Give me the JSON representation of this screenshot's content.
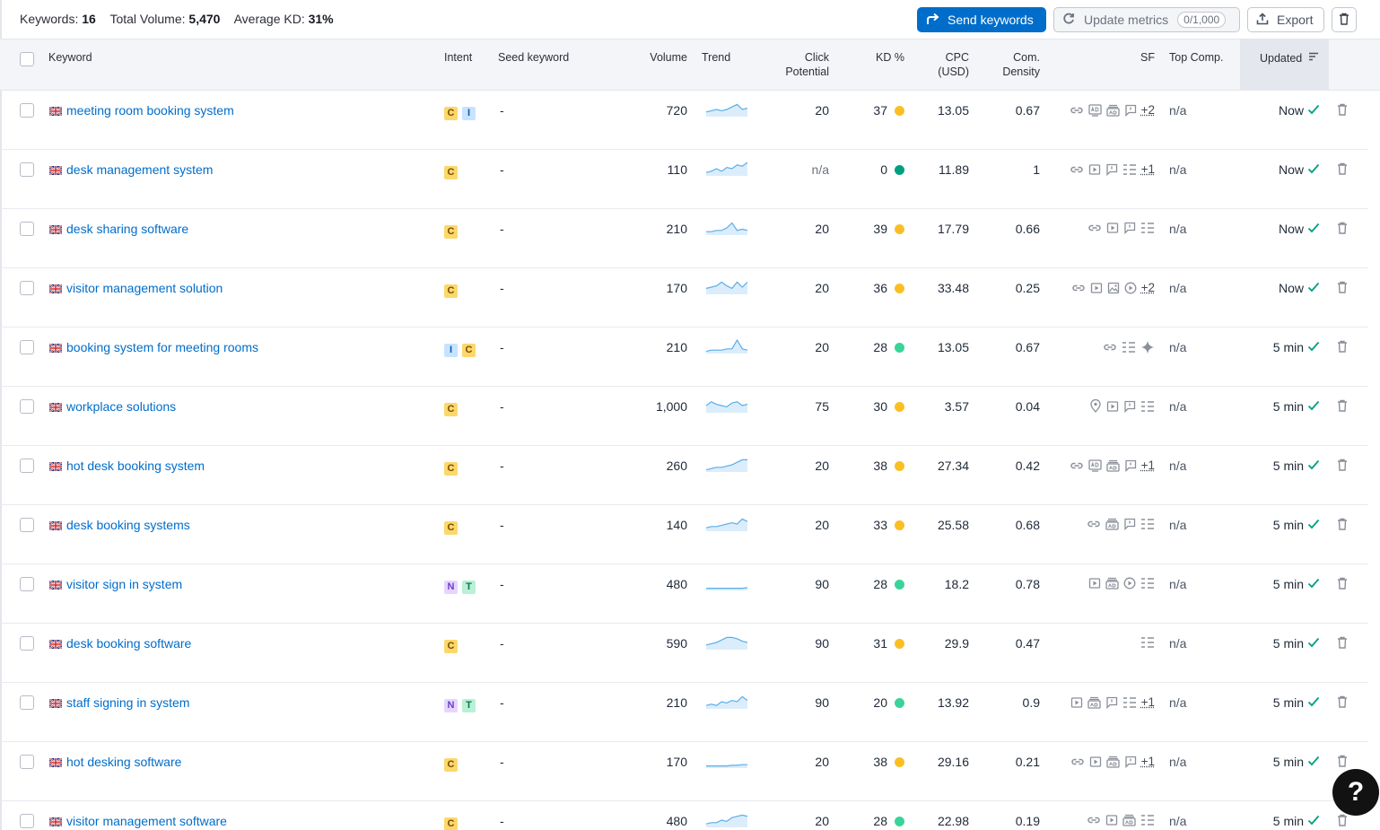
{
  "stats": {
    "keywords_label": "Keywords:",
    "keywords_value": "16",
    "volume_label": "Total Volume:",
    "volume_value": "5,470",
    "kd_label": "Average KD:",
    "kd_value": "31%"
  },
  "toolbar": {
    "send_label": "Send keywords",
    "update_label": "Update metrics",
    "update_limit": "0/1,000",
    "export_label": "Export"
  },
  "columns": {
    "keyword": "Keyword",
    "intent": "Intent",
    "seed": "Seed keyword",
    "volume": "Volume",
    "trend": "Trend",
    "click_1": "Click",
    "click_2": "Potential",
    "kd": "KD %",
    "cpc_1": "CPC",
    "cpc_2": "(USD)",
    "com_1": "Com.",
    "com_2": "Density",
    "sf": "SF",
    "top": "Top Comp.",
    "updated": "Updated"
  },
  "colors": {
    "link": "#006dca",
    "kd_yellow": "#fbbf24",
    "kd_green": "#3ad49a",
    "kd_teal": "#009f81",
    "trend": "#5aaee8"
  },
  "rows": [
    {
      "keyword": "meeting room booking system",
      "intents": [
        "C",
        "I"
      ],
      "seed": "-",
      "volume": "720",
      "trend": [
        0.3,
        0.4,
        0.5,
        0.4,
        0.5,
        0.7,
        0.9,
        0.5,
        0.6
      ],
      "click": "20",
      "kd": "37",
      "kd_color": "yellow",
      "cpc": "13.05",
      "com": "0.67",
      "sf": [
        "link-icon",
        "ads-icon",
        "image-pack-icon",
        "review-icon"
      ],
      "sf_more": "+2",
      "top": "n/a",
      "updated": "Now"
    },
    {
      "keyword": "desk management system",
      "intents": [
        "C"
      ],
      "seed": "-",
      "volume": "110",
      "trend": [
        0.2,
        0.3,
        0.5,
        0.3,
        0.6,
        0.5,
        0.8,
        0.7,
        1.0
      ],
      "click": "n/a",
      "kd": "0",
      "kd_color": "teal",
      "cpc": "11.89",
      "com": "1",
      "sf": [
        "link-icon",
        "video-icon",
        "review-icon",
        "list-icon"
      ],
      "sf_more": "+1",
      "top": "n/a",
      "updated": "Now"
    },
    {
      "keyword": "desk sharing software",
      "intents": [
        "C"
      ],
      "seed": "-",
      "volume": "210",
      "trend": [
        0.2,
        0.2,
        0.3,
        0.3,
        0.5,
        0.9,
        0.3,
        0.4,
        0.3
      ],
      "click": "20",
      "kd": "39",
      "kd_color": "yellow",
      "cpc": "17.79",
      "com": "0.66",
      "sf": [
        "link-icon",
        "video-icon",
        "review-icon",
        "list-icon"
      ],
      "sf_more": "",
      "top": "n/a",
      "updated": "Now"
    },
    {
      "keyword": "visitor management solution",
      "intents": [
        "C"
      ],
      "seed": "-",
      "volume": "170",
      "trend": [
        0.4,
        0.5,
        0.6,
        0.9,
        0.6,
        0.4,
        0.9,
        0.5,
        0.9
      ],
      "click": "20",
      "kd": "36",
      "kd_color": "yellow",
      "cpc": "33.48",
      "com": "0.25",
      "sf": [
        "link-icon",
        "video-icon",
        "image-icon",
        "play-icon"
      ],
      "sf_more": "+2",
      "top": "n/a",
      "updated": "Now"
    },
    {
      "keyword": "booking system for meeting rooms",
      "intents": [
        "I",
        "C"
      ],
      "seed": "-",
      "volume": "210",
      "trend": [
        0.1,
        0.2,
        0.2,
        0.2,
        0.3,
        0.3,
        1.0,
        0.3,
        0.2
      ],
      "click": "20",
      "kd": "28",
      "kd_color": "green",
      "cpc": "13.05",
      "com": "0.67",
      "sf": [
        "link-icon",
        "list-icon",
        "ai-icon"
      ],
      "sf_more": "",
      "top": "n/a",
      "updated": "5 min"
    },
    {
      "keyword": "workplace solutions",
      "intents": [
        "C"
      ],
      "seed": "-",
      "volume": "1,000",
      "trend": [
        0.5,
        0.8,
        0.6,
        0.5,
        0.4,
        0.7,
        0.8,
        0.5,
        0.6
      ],
      "click": "75",
      "kd": "30",
      "kd_color": "yellow",
      "cpc": "3.57",
      "com": "0.04",
      "sf": [
        "location-icon",
        "video-icon",
        "review-icon",
        "list-icon"
      ],
      "sf_more": "",
      "top": "n/a",
      "updated": "5 min"
    },
    {
      "keyword": "hot desk booking system",
      "intents": [
        "C"
      ],
      "seed": "-",
      "volume": "260",
      "trend": [
        0.1,
        0.2,
        0.3,
        0.3,
        0.4,
        0.5,
        0.7,
        0.9,
        0.9
      ],
      "click": "20",
      "kd": "38",
      "kd_color": "yellow",
      "cpc": "27.34",
      "com": "0.42",
      "sf": [
        "link-icon",
        "ads-icon",
        "image-pack-icon",
        "review-icon"
      ],
      "sf_more": "+1",
      "top": "n/a",
      "updated": "5 min"
    },
    {
      "keyword": "desk booking systems",
      "intents": [
        "C"
      ],
      "seed": "-",
      "volume": "140",
      "trend": [
        0.2,
        0.3,
        0.3,
        0.4,
        0.5,
        0.6,
        0.5,
        0.9,
        0.7
      ],
      "click": "20",
      "kd": "33",
      "kd_color": "yellow",
      "cpc": "25.58",
      "com": "0.68",
      "sf": [
        "link-icon",
        "image-pack-icon",
        "review-icon",
        "list-icon"
      ],
      "sf_more": "",
      "top": "n/a",
      "updated": "5 min"
    },
    {
      "keyword": "visitor sign in system",
      "intents": [
        "N",
        "T"
      ],
      "seed": "-",
      "volume": "480",
      "trend": [
        0.1,
        0.1,
        0.1,
        0.1,
        0.1,
        0.1,
        0.1,
        0.1,
        0.15
      ],
      "click": "90",
      "kd": "28",
      "kd_color": "green",
      "cpc": "18.2",
      "com": "0.78",
      "sf": [
        "video-icon",
        "image-pack-icon",
        "play-icon",
        "list-icon"
      ],
      "sf_more": "",
      "top": "n/a",
      "updated": "5 min"
    },
    {
      "keyword": "desk booking software",
      "intents": [
        "C"
      ],
      "seed": "-",
      "volume": "590",
      "trend": [
        0.3,
        0.4,
        0.5,
        0.7,
        0.9,
        0.9,
        0.8,
        0.6,
        0.5
      ],
      "click": "90",
      "kd": "31",
      "kd_color": "yellow",
      "cpc": "29.9",
      "com": "0.47",
      "sf": [
        "list-icon"
      ],
      "sf_more": "",
      "top": "n/a",
      "updated": "5 min"
    },
    {
      "keyword": "staff signing in system",
      "intents": [
        "N",
        "T"
      ],
      "seed": "-",
      "volume": "210",
      "trend": [
        0.2,
        0.3,
        0.2,
        0.5,
        0.4,
        0.6,
        0.5,
        0.9,
        0.6
      ],
      "click": "90",
      "kd": "20",
      "kd_color": "green",
      "cpc": "13.92",
      "com": "0.9",
      "sf": [
        "video-icon",
        "image-pack-icon",
        "review-icon",
        "list-icon"
      ],
      "sf_more": "+1",
      "top": "n/a",
      "updated": "5 min"
    },
    {
      "keyword": "hot desking software",
      "intents": [
        "C"
      ],
      "seed": "-",
      "volume": "170",
      "trend": [
        0.1,
        0.1,
        0.1,
        0.1,
        0.1,
        0.15,
        0.15,
        0.2,
        0.2
      ],
      "click": "20",
      "kd": "38",
      "kd_color": "yellow",
      "cpc": "29.16",
      "com": "0.21",
      "sf": [
        "link-icon",
        "video-icon",
        "image-pack-icon",
        "review-icon"
      ],
      "sf_more": "+1",
      "top": "n/a",
      "updated": "5 min"
    },
    {
      "keyword": "visitor management software",
      "intents": [
        "C"
      ],
      "seed": "-",
      "volume": "480",
      "trend": [
        0.2,
        0.3,
        0.3,
        0.5,
        0.4,
        0.7,
        0.8,
        0.9,
        0.8
      ],
      "click": "20",
      "kd": "28",
      "kd_color": "green",
      "cpc": "22.98",
      "com": "0.19",
      "sf": [
        "link-icon",
        "video-icon",
        "image-pack-icon",
        "list-icon"
      ],
      "sf_more": "",
      "top": "n/a",
      "updated": "5 min"
    }
  ],
  "help_label": "?"
}
